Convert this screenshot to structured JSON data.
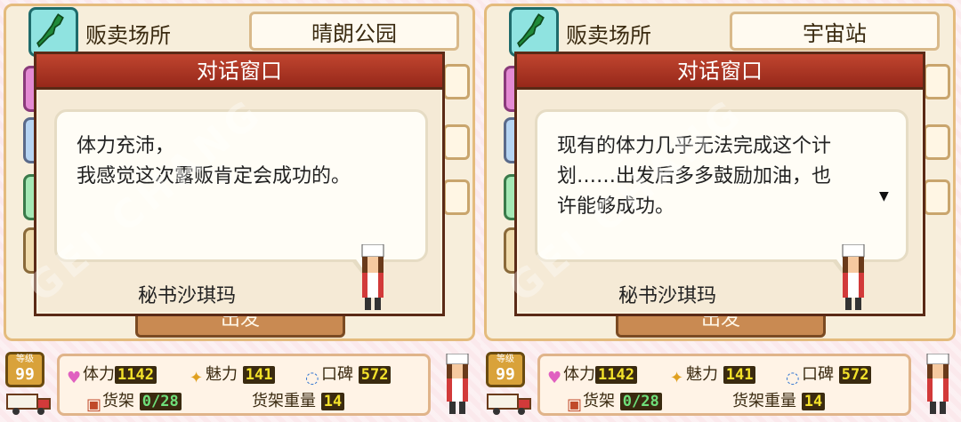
{
  "panels": [
    {
      "venue_label": "贩卖场所",
      "venue_value": "晴朗公园",
      "dialog": {
        "title": "对话窗口",
        "lines": [
          "体力充沛，",
          "我感觉这次露贩肯定会成功的。"
        ],
        "speaker": "秘书沙琪玛",
        "show_more_arrow": false
      },
      "depart_button": "出发",
      "status": {
        "level_label": "等级",
        "level": "99",
        "stamina_label": "体力",
        "stamina": "1142",
        "charm_label": "魅力",
        "charm": "141",
        "reputation_label": "口碑",
        "reputation": "572",
        "shelf_label": "货架",
        "shelf": "0/28",
        "shelf_weight_label": "货架重量",
        "shelf_weight": "14"
      }
    },
    {
      "venue_label": "贩卖场所",
      "venue_value": "宇宙站",
      "dialog": {
        "title": "对话窗口",
        "lines": [
          "现有的体力几乎无法完成这个计",
          "划……出发后多多鼓励加油，也",
          "许能够成功。"
        ],
        "speaker": "秘书沙琪玛",
        "show_more_arrow": true
      },
      "depart_button": "出发",
      "status": {
        "level_label": "等级",
        "level": "99",
        "stamina_label": "体力",
        "stamina": "1142",
        "charm_label": "魅力",
        "charm": "141",
        "reputation_label": "口碑",
        "reputation": "572",
        "shelf_label": "货架",
        "shelf": "0/28",
        "shelf_weight_label": "货架重量",
        "shelf_weight": "14"
      }
    }
  ],
  "watermark_text": "GEI CHANG",
  "colors": {
    "title_bar": "#b0371f",
    "dialog_border": "#5a2a16",
    "stat_number": "#f4e22a",
    "shelf_number": "#6fe07a"
  },
  "icons": [
    "map-icon",
    "heart-icon",
    "star-icon",
    "speech-bubble-icon",
    "shelf-icon",
    "truck-icon",
    "more-arrow-icon"
  ]
}
